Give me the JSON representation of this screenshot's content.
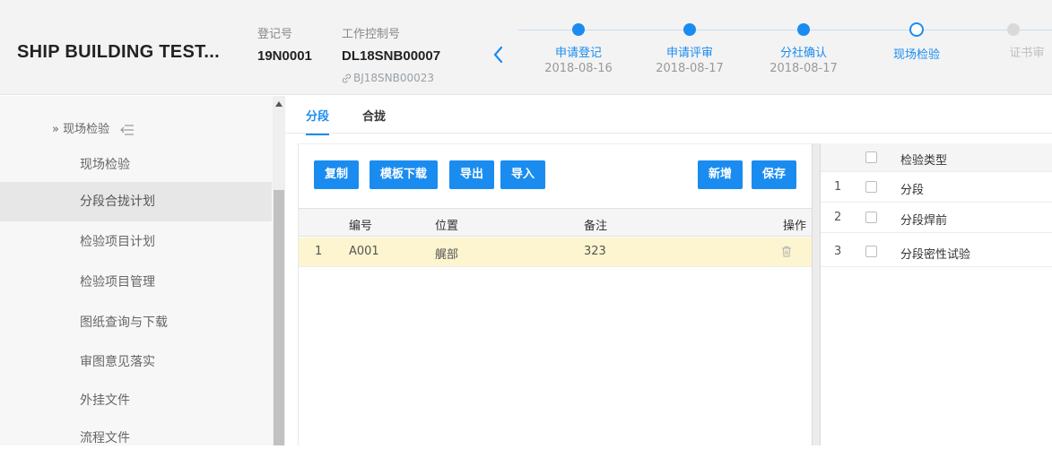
{
  "header": {
    "project_title": "SHIP BUILDING TEST...",
    "reg_label": "登记号",
    "reg_value": "19N0001",
    "ctrl_label": "工作控制号",
    "ctrl_value": "DL18SNB00007",
    "ctrl_link": "BJ18SNB00023",
    "steps": [
      {
        "label": "申请登记",
        "date": "2018-08-16",
        "state": "done"
      },
      {
        "label": "申请评审",
        "date": "2018-08-17",
        "state": "done"
      },
      {
        "label": "分社确认",
        "date": "2018-08-17",
        "state": "done"
      },
      {
        "label": "现场检验",
        "date": "",
        "state": "current"
      },
      {
        "label": "证书审",
        "date": "",
        "state": "pending"
      }
    ]
  },
  "sidebar": {
    "group_label": "» 现场检验",
    "items": [
      {
        "label": "现场检验",
        "active": false
      },
      {
        "label": "分段合拢计划",
        "active": true
      },
      {
        "label": "检验项目计划",
        "active": false
      },
      {
        "label": "检验项目管理",
        "active": false
      },
      {
        "label": "图纸查询与下载",
        "active": false
      },
      {
        "label": "审图意见落实",
        "active": false
      },
      {
        "label": "外挂文件",
        "active": false
      },
      {
        "label": "流程文件",
        "active": false
      }
    ]
  },
  "tabs": [
    {
      "label": "分段",
      "active": true
    },
    {
      "label": "合拢",
      "active": false
    }
  ],
  "toolbar": {
    "copy": "复制",
    "template_download": "模板下载",
    "export": "导出",
    "import": "导入",
    "add": "新增",
    "save": "保存"
  },
  "grid": {
    "columns": [
      "编号",
      "位置",
      "备注",
      "操作"
    ],
    "rows": [
      {
        "index": "1",
        "code": "A001",
        "location": "艉部",
        "remark": "323"
      }
    ]
  },
  "inspection_types": {
    "header": "检验类型",
    "rows": [
      {
        "index": "1",
        "label": "分段"
      },
      {
        "index": "2",
        "label": "分段焊前"
      },
      {
        "index": "3",
        "label": "分段密性试验"
      }
    ]
  },
  "colors": {
    "accent": "#1a8cf0",
    "selected_row": "#fdf5cf",
    "active_side_item": "#e7e7e7"
  },
  "icons": [
    "back-chevron-icon",
    "link-icon",
    "collapse-menu-icon",
    "trash-icon",
    "scroll-up-arrow-icon"
  ]
}
